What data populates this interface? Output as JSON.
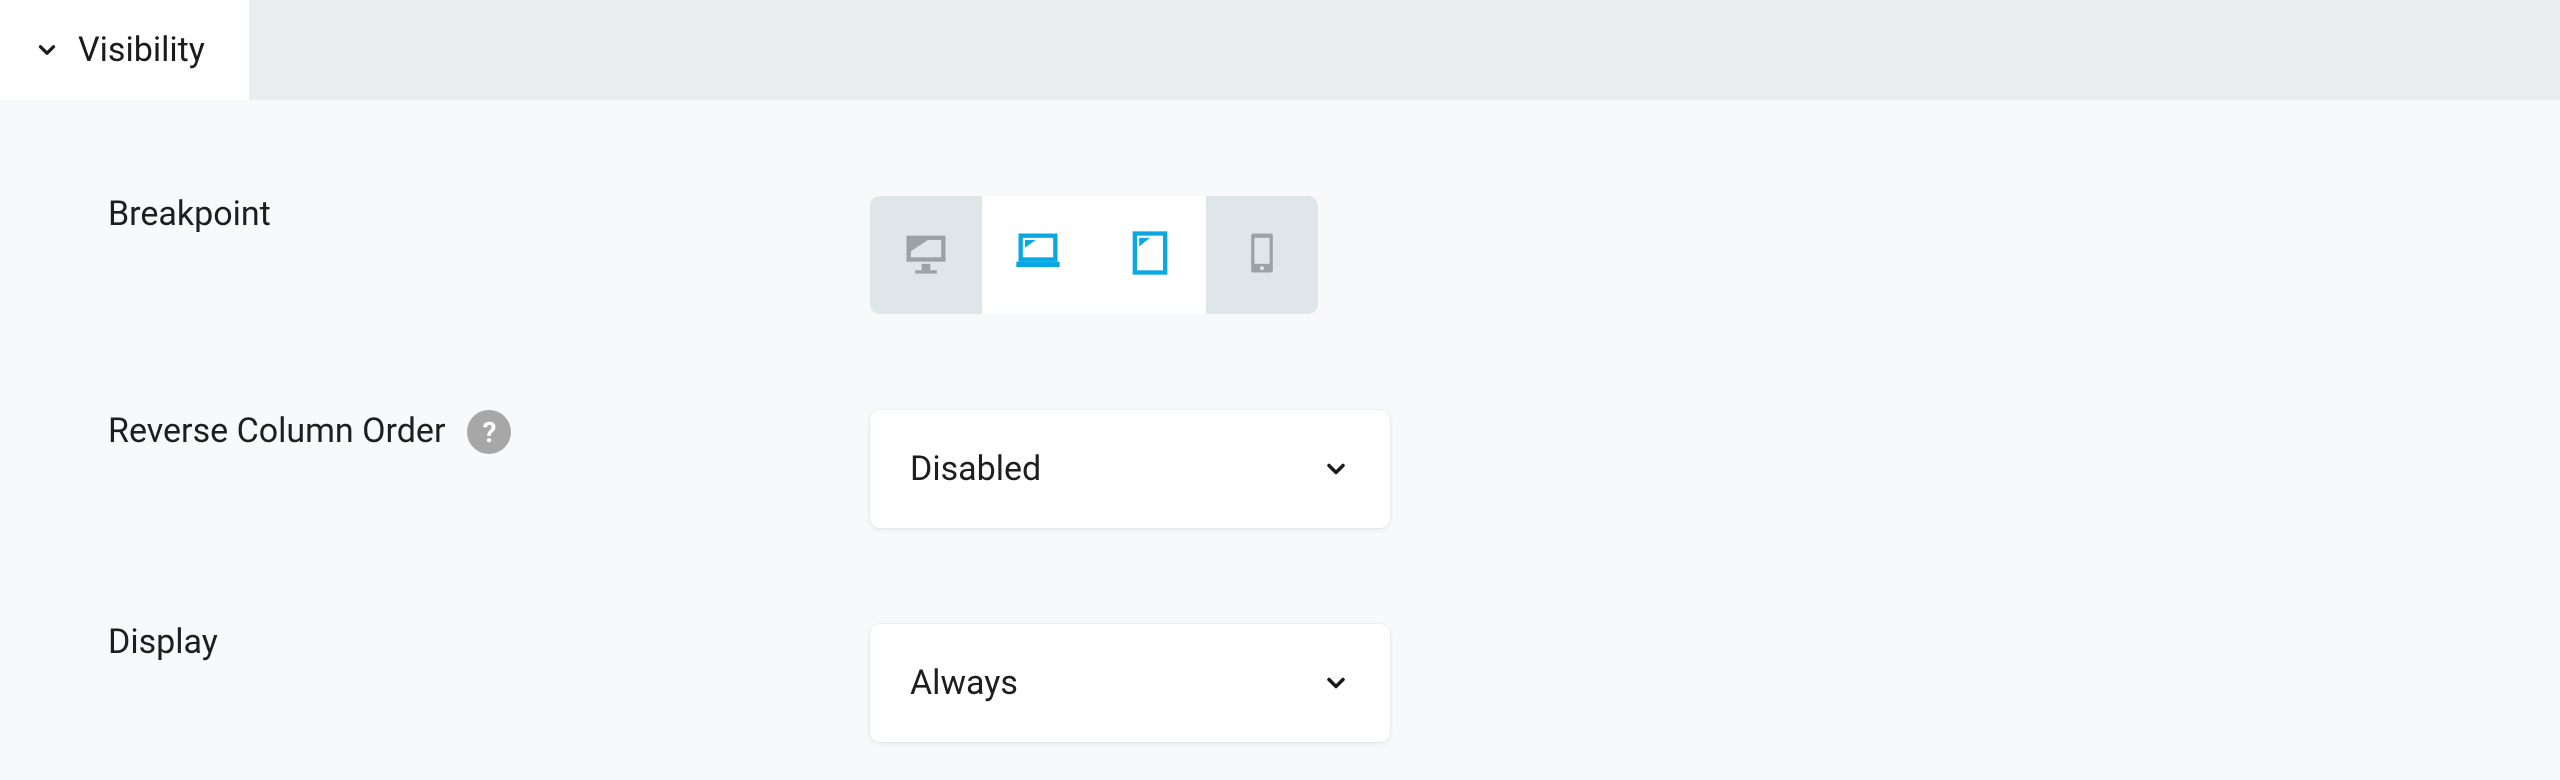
{
  "section": {
    "title": "Visibility"
  },
  "fields": {
    "breakpoint": {
      "label": "Breakpoint",
      "options": [
        {
          "id": "xl",
          "icon": "desktop-icon",
          "selected": false
        },
        {
          "id": "laptop",
          "icon": "laptop-icon",
          "selected": true
        },
        {
          "id": "tablet",
          "icon": "tablet-icon",
          "selected": true
        },
        {
          "id": "mobile",
          "icon": "mobile-icon",
          "selected": false
        }
      ]
    },
    "reverse_column_order": {
      "label": "Reverse Column Order",
      "help_glyph": "?",
      "value": "Disabled"
    },
    "display": {
      "label": "Display",
      "value": "Always"
    }
  }
}
